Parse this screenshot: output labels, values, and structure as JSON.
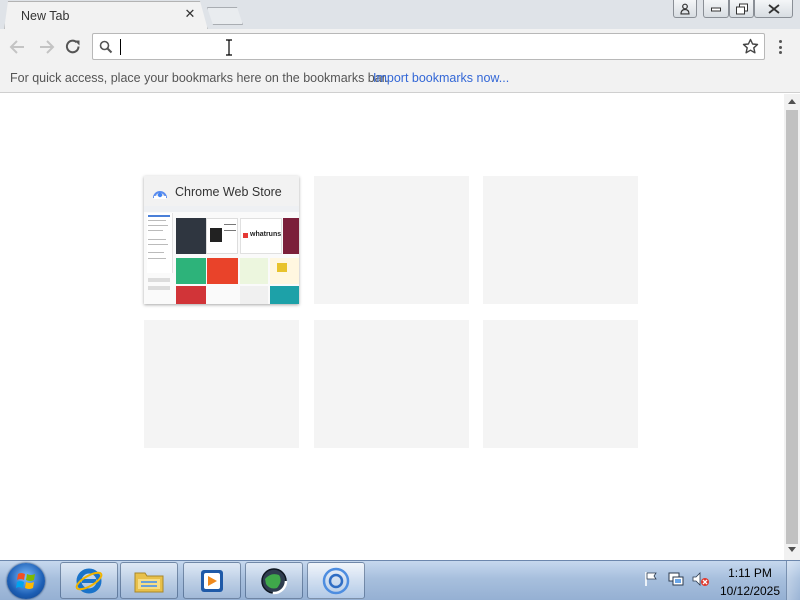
{
  "tab": {
    "title": "New Tab",
    "close_icon": "close-icon"
  },
  "window_controls": {
    "icons": [
      "profile-icon",
      "minimize-icon",
      "maximize-icon",
      "close-icon"
    ]
  },
  "toolbar": {
    "icons": [
      "back-arrow-icon",
      "forward-arrow-icon",
      "reload-icon",
      "search-icon",
      "star-icon",
      "menu-dots-icon"
    ],
    "omnibox": {
      "value": "",
      "placeholder": ""
    }
  },
  "bookmarks_bar": {
    "hint": "For quick access, place your bookmarks here on the bookmarks bar.",
    "import_link": "Import bookmarks now..."
  },
  "most_visited": {
    "tiles": [
      {
        "title": "Chrome Web Store",
        "thumb_brand": "whatruns"
      },
      {
        "title": ""
      },
      {
        "title": ""
      },
      {
        "title": ""
      },
      {
        "title": ""
      },
      {
        "title": ""
      }
    ]
  },
  "taskbar": {
    "items": [
      "windows-start-icon",
      "internet-explorer-icon",
      "file-explorer-icon",
      "media-player-icon",
      "app-globe-icon",
      "chrome-icon"
    ],
    "tray_icons": [
      "action-center-flag-icon",
      "network-icon",
      "volume-muted-icon"
    ],
    "clock": {
      "time": "1:11 PM",
      "date": "10/12/2025"
    }
  },
  "colors": {
    "link": "#3367d6",
    "tabstrip": "#dfe3e8",
    "toolbar": "#f2f2f2",
    "taskbar": "#a7bfdd"
  }
}
